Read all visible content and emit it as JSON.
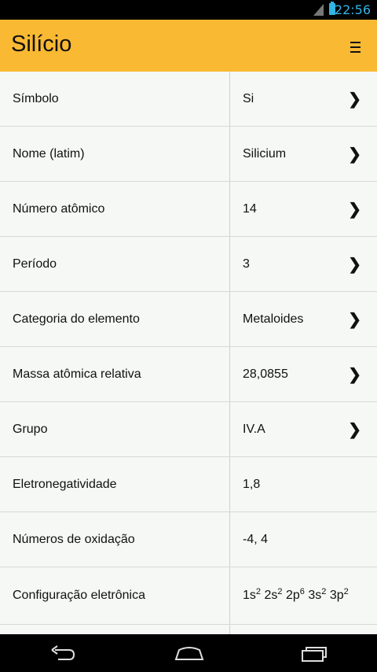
{
  "status_bar": {
    "time": "22:56"
  },
  "app_bar": {
    "title": "Silício",
    "menu_icon": "overflow-menu-icon"
  },
  "rows": [
    {
      "label": "Símbolo",
      "value": "Si",
      "has_arrow": true
    },
    {
      "label": "Nome (latim)",
      "value": "Silicium",
      "has_arrow": true
    },
    {
      "label": "Número atômico",
      "value": "14",
      "has_arrow": true
    },
    {
      "label": "Período",
      "value": "3",
      "has_arrow": true
    },
    {
      "label": "Categoria do elemento",
      "value": "Metaloides",
      "has_arrow": true
    },
    {
      "label": "Massa atômica relativa",
      "value": "28,0855",
      "has_arrow": true
    },
    {
      "label": "Grupo",
      "value": "IV.A",
      "has_arrow": true
    },
    {
      "label": "Eletronegatividade",
      "value": "1,8",
      "has_arrow": false
    },
    {
      "label": "Números de oxidação",
      "value": "-4, 4",
      "has_arrow": false
    }
  ],
  "electron_configuration": {
    "label": "Configuração eletrônica",
    "parts": [
      {
        "orbital": "1s",
        "count": "2"
      },
      {
        "orbital": "2s",
        "count": "2"
      },
      {
        "orbital": "2p",
        "count": "6"
      },
      {
        "orbital": "3s",
        "count": "2"
      },
      {
        "orbital": "3p",
        "count": "2"
      }
    ]
  },
  "nav_icons": [
    "back-icon",
    "home-icon",
    "recent-apps-icon"
  ],
  "colors": {
    "app_bar": "#f9b933",
    "status_time": "#33b5e5",
    "background": "#f5f8f4"
  }
}
